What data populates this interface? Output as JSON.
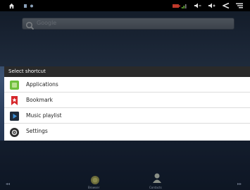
{
  "status_bar": {
    "left_icons": [
      "home-icon",
      "notification-icon",
      "notification-icon"
    ],
    "right_icons": [
      "battery-icon",
      "signal-icon",
      "volume-down-icon",
      "volume-up-icon",
      "back-icon",
      "menu-icon"
    ]
  },
  "search": {
    "placeholder": "Google",
    "icon": "search-icon"
  },
  "dialog": {
    "title": "Select shortcut",
    "items": [
      {
        "label": "Applications",
        "icon": "applications-icon"
      },
      {
        "label": "Bookmark",
        "icon": "bookmark-icon"
      },
      {
        "label": "Music playlist",
        "icon": "music-playlist-icon"
      },
      {
        "label": "Settings",
        "icon": "settings-icon"
      }
    ]
  },
  "dock": {
    "items": [
      {
        "label": "Browser",
        "icon": "browser-icon"
      },
      {
        "label": "Contacts",
        "icon": "contacts-icon"
      }
    ]
  },
  "colors": {
    "status_bar": "#000000",
    "dialog_title_bg": "#2a2a2a",
    "dialog_bg": "#ffffff",
    "accent_green": "#6fbf3c",
    "bookmark_red": "#d6262a",
    "music_blue": "#1f6fb4"
  }
}
